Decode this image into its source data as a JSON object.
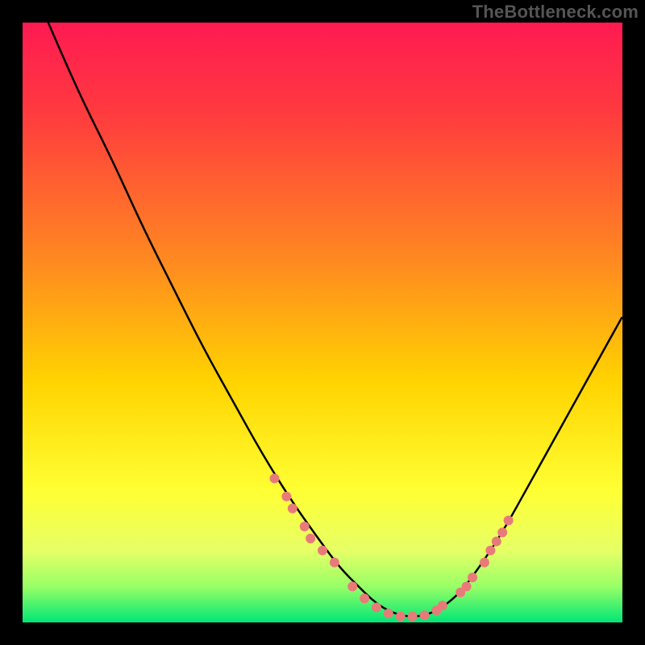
{
  "watermark": "TheBottleneck.com",
  "chart_data": {
    "type": "line",
    "title": "",
    "xlabel": "",
    "ylabel": "",
    "xlim": [
      0,
      100
    ],
    "ylim": [
      0,
      100
    ],
    "gradient_stops": [
      {
        "offset": 0.0,
        "color": "#ff1a52"
      },
      {
        "offset": 0.15,
        "color": "#ff3a3f"
      },
      {
        "offset": 0.4,
        "color": "#ff8a20"
      },
      {
        "offset": 0.6,
        "color": "#ffd400"
      },
      {
        "offset": 0.78,
        "color": "#ffff33"
      },
      {
        "offset": 0.88,
        "color": "#e6ff66"
      },
      {
        "offset": 0.94,
        "color": "#99ff66"
      },
      {
        "offset": 1.0,
        "color": "#00e676"
      }
    ],
    "series": [
      {
        "name": "bottleneck-curve",
        "color": "#000000",
        "x": [
          0,
          3,
          6,
          10,
          15,
          20,
          25,
          30,
          35,
          40,
          45,
          50,
          53,
          56,
          58,
          60,
          62,
          64,
          66,
          68,
          70,
          73,
          76,
          80,
          85,
          90,
          95,
          100
        ],
        "y": [
          110,
          103,
          96,
          87,
          77,
          66,
          56,
          46,
          37,
          28,
          20,
          13,
          9,
          6,
          4,
          2.5,
          1.5,
          1,
          1,
          1.5,
          2.5,
          5,
          9,
          15,
          24,
          33,
          42,
          51
        ]
      }
    ],
    "markers": {
      "name": "highlighted-range",
      "color": "#e97a7a",
      "radius": 6,
      "points": [
        {
          "x": 42,
          "y": 24
        },
        {
          "x": 44,
          "y": 21
        },
        {
          "x": 45,
          "y": 19
        },
        {
          "x": 47,
          "y": 16
        },
        {
          "x": 48,
          "y": 14
        },
        {
          "x": 50,
          "y": 12
        },
        {
          "x": 52,
          "y": 10
        },
        {
          "x": 55,
          "y": 6
        },
        {
          "x": 57,
          "y": 4
        },
        {
          "x": 59,
          "y": 2.5
        },
        {
          "x": 61,
          "y": 1.5
        },
        {
          "x": 63,
          "y": 1
        },
        {
          "x": 65,
          "y": 1
        },
        {
          "x": 67,
          "y": 1.2
        },
        {
          "x": 69,
          "y": 2
        },
        {
          "x": 70,
          "y": 2.8
        },
        {
          "x": 73,
          "y": 5
        },
        {
          "x": 74,
          "y": 6
        },
        {
          "x": 75,
          "y": 7.5
        },
        {
          "x": 77,
          "y": 10
        },
        {
          "x": 78,
          "y": 12
        },
        {
          "x": 79,
          "y": 13.5
        },
        {
          "x": 80,
          "y": 15
        },
        {
          "x": 81,
          "y": 17
        }
      ]
    }
  }
}
